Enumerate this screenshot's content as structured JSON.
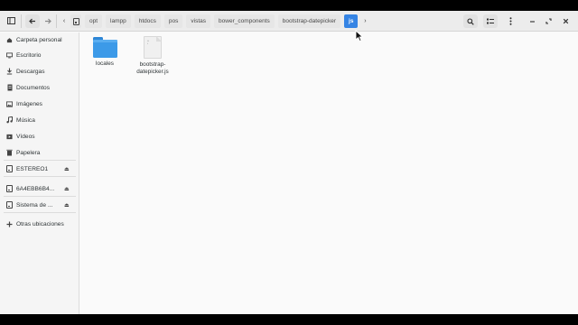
{
  "header": {
    "breadcrumbs": [
      "opt",
      "lampp",
      "htdocs",
      "pos",
      "vistas",
      "bower_components",
      "bootstrap-datepicker",
      "js"
    ],
    "active_crumb": "js",
    "icons": [
      "sidebar-icon",
      "back-arrow-icon",
      "forward-arrow-icon",
      "chevron-left-icon",
      "drive-icon",
      "chevron-right-icon",
      "search-icon",
      "list-view-icon",
      "menu-dots-icon",
      "minimize-icon",
      "maximize-icon",
      "close-icon"
    ]
  },
  "sidebar": {
    "items": [
      {
        "label": "Carpeta personal",
        "icon": "home-icon"
      },
      {
        "label": "Escritorio",
        "icon": "desktop-icon"
      },
      {
        "label": "Descargas",
        "icon": "download-icon"
      },
      {
        "label": "Documentos",
        "icon": "document-icon"
      },
      {
        "label": "Imágenes",
        "icon": "image-icon"
      },
      {
        "label": "Música",
        "icon": "music-icon"
      },
      {
        "label": "Vídeos",
        "icon": "video-icon"
      },
      {
        "label": "Papelera",
        "icon": "trash-icon"
      },
      {
        "label": "ESTEREO1",
        "icon": "drive-icon",
        "eject": true
      },
      {
        "label": "6A4EBB6B4...",
        "icon": "drive-icon",
        "eject": true
      },
      {
        "label": "Sistema de ...",
        "icon": "drive-icon",
        "eject": true
      },
      {
        "label": "Otras ubicaciones",
        "icon": "plus-icon"
      }
    ]
  },
  "files": [
    {
      "label": "locales",
      "type": "folder"
    },
    {
      "label": "bootstrap-\ndatepicker.js",
      "type": "file"
    }
  ],
  "colors": {
    "accent": "#3584e4",
    "folder": "#3c9ae8"
  }
}
